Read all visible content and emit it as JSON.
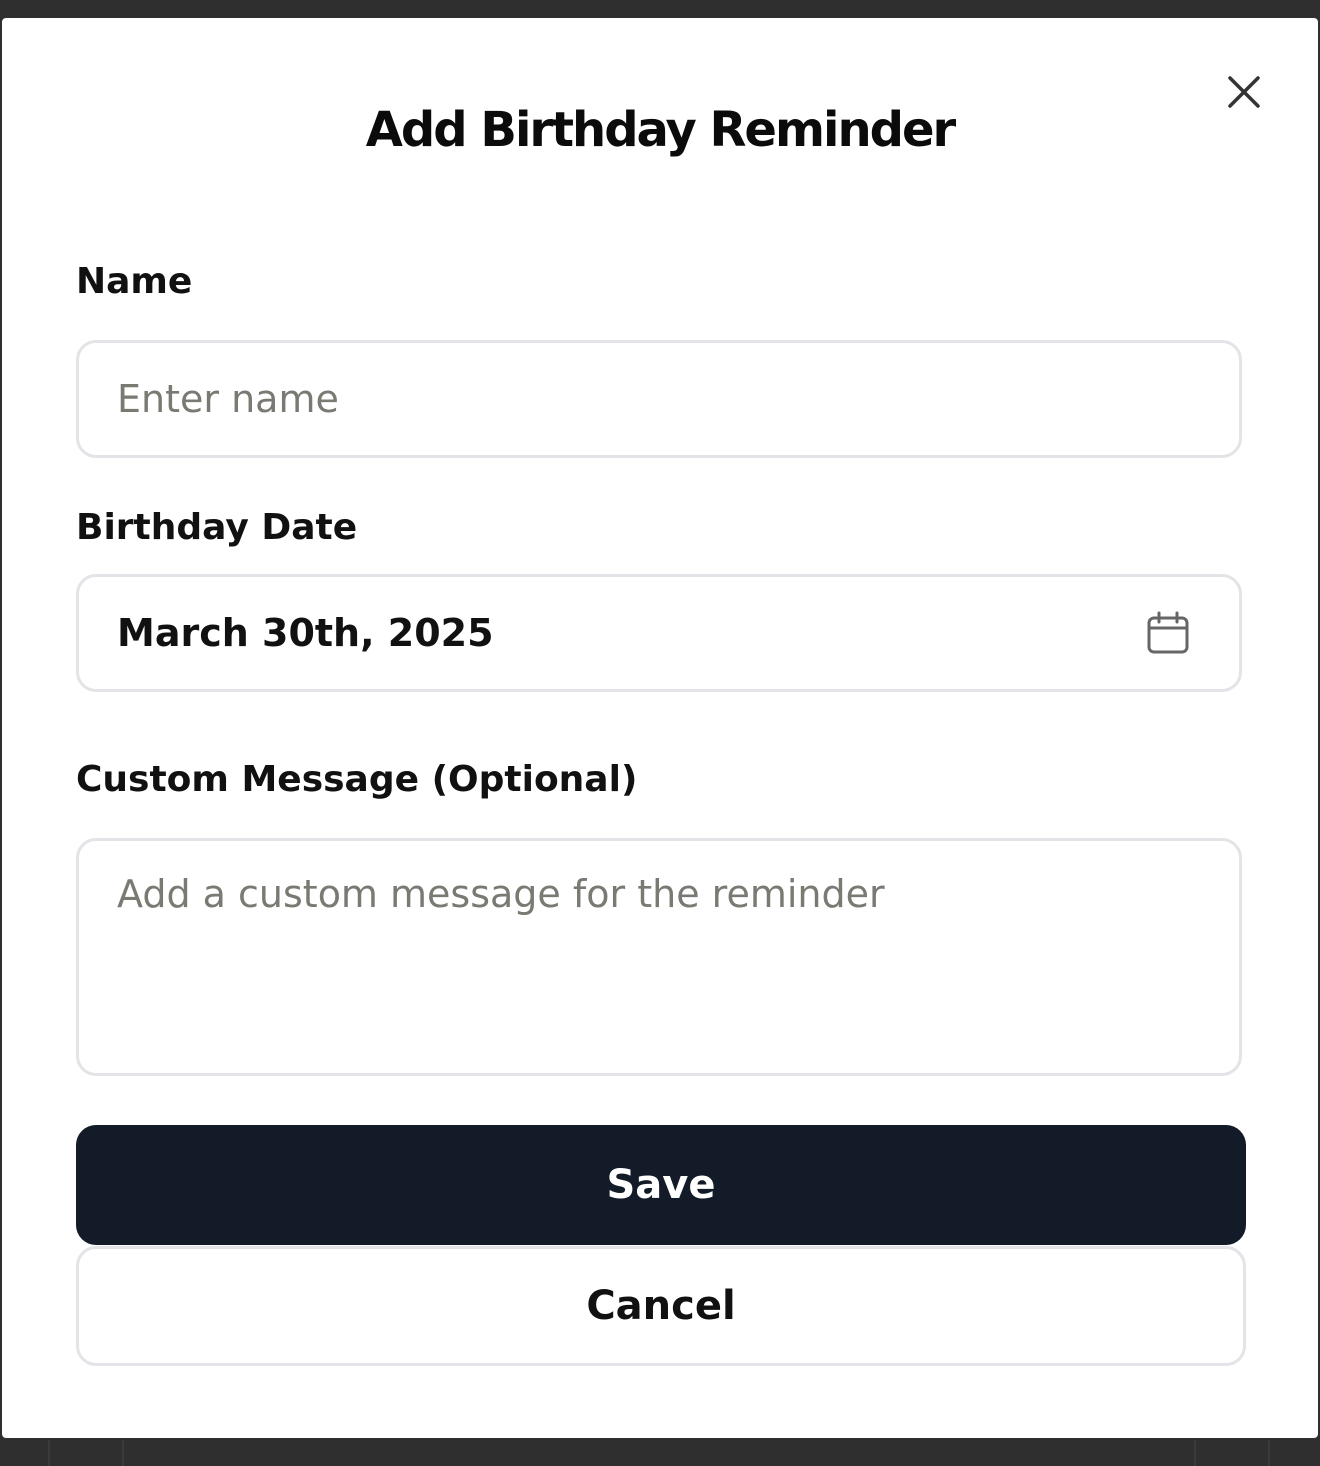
{
  "dialog": {
    "title": "Add Birthday Reminder",
    "close_icon": "close-icon"
  },
  "form": {
    "name": {
      "label": "Name",
      "value": "",
      "placeholder": "Enter name"
    },
    "birthday_date": {
      "label": "Birthday Date",
      "value": "March 30th, 2025",
      "icon": "calendar-icon"
    },
    "custom_message": {
      "label": "Custom Message (Optional)",
      "value": "",
      "placeholder": "Add a custom message for the reminder"
    }
  },
  "actions": {
    "save_label": "Save",
    "cancel_label": "Cancel"
  },
  "colors": {
    "primary_button": "#131a28",
    "border": "#e3e4e8",
    "placeholder": "#7a7a73"
  }
}
